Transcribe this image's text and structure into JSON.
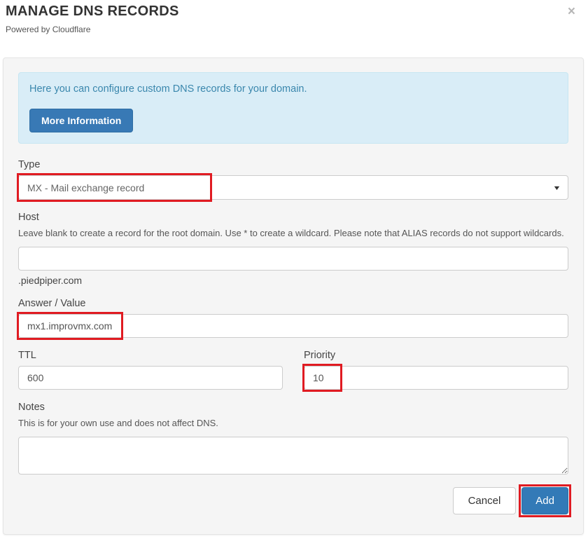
{
  "dialog": {
    "title": "MANAGE DNS RECORDS",
    "subtitle": "Powered by Cloudflare"
  },
  "icons": {
    "close": "×",
    "caret_down": "▼"
  },
  "info": {
    "message": "Here you can configure custom DNS records for your domain.",
    "more_info_label": "More Information"
  },
  "form": {
    "type": {
      "label": "Type",
      "value": "MX - Mail exchange record"
    },
    "host": {
      "label": "Host",
      "hint": "Leave blank to create a record for the root domain. Use * to create a wildcard. Please note that ALIAS records do not support wildcards.",
      "value": "",
      "suffix": ".piedpiper.com"
    },
    "answer": {
      "label": "Answer / Value",
      "value": "mx1.improvmx.com"
    },
    "ttl": {
      "label": "TTL",
      "value": "600"
    },
    "priority": {
      "label": "Priority",
      "value": "10"
    },
    "notes": {
      "label": "Notes",
      "hint": "This is for your own use and does not affect DNS.",
      "value": ""
    }
  },
  "actions": {
    "cancel_label": "Cancel",
    "add_label": "Add"
  },
  "colors": {
    "accent": "#337ab7",
    "annotation": "#e01b22",
    "info_bg": "#d9edf7",
    "info_text": "#3a87ad",
    "panel_bg": "#f5f5f5"
  }
}
